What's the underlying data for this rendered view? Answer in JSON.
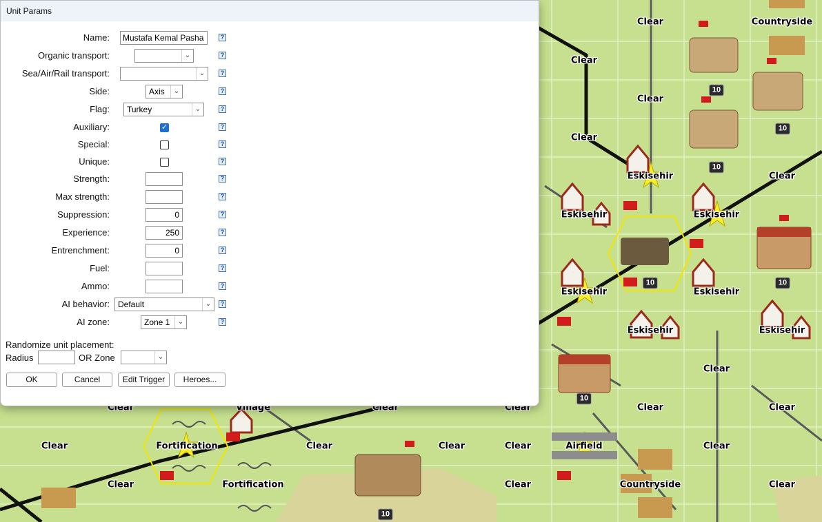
{
  "dialog": {
    "title": "Unit Params",
    "name_label": "Name:",
    "name_value": "Mustafa Kemal Pasha",
    "organic_transport_label": "Organic transport:",
    "organic_transport_value": "",
    "sea_air_rail_label": "Sea/Air/Rail transport:",
    "sea_air_rail_value": "",
    "side_label": "Side:",
    "side_value": "Axis",
    "flag_label": "Flag:",
    "flag_value": "Turkey",
    "auxiliary_label": "Auxiliary:",
    "auxiliary_checked": true,
    "special_label": "Special:",
    "special_checked": false,
    "unique_label": "Unique:",
    "unique_checked": false,
    "strength_label": "Strength:",
    "strength_value": "",
    "max_strength_label": "Max strength:",
    "max_strength_value": "",
    "suppression_label": "Suppression:",
    "suppression_value": "0",
    "experience_label": "Experience:",
    "experience_value": "250",
    "entrenchment_label": "Entrenchment:",
    "entrenchment_value": "0",
    "fuel_label": "Fuel:",
    "fuel_value": "",
    "ammo_label": "Ammo:",
    "ammo_value": "",
    "ai_behavior_label": "AI behavior:",
    "ai_behavior_value": "Default",
    "ai_zone_label": "AI zone:",
    "ai_zone_value": "Zone 1",
    "randomize_label": "Randomize unit placement:",
    "radius_label": "Radius",
    "radius_value": "",
    "or_zone_label": "OR Zone",
    "or_zone_value": "",
    "help_glyph": "?",
    "checkmark_glyph": "✓",
    "arrow_glyph": "⌄",
    "buttons": {
      "ok": "OK",
      "cancel": "Cancel",
      "edit_trigger": "Edit Trigger",
      "heroes": "Heroes..."
    }
  },
  "map": {
    "colors": {
      "terrain": "#c6e08f",
      "hex_line": "#e8f2cf",
      "road": "#5a5a5a",
      "rail": "#111111",
      "highlight": "#f2e600"
    },
    "labels": [
      {
        "text": "Clear"
      },
      {
        "text": "Countryside"
      },
      {
        "text": "Clear"
      },
      {
        "text": "Clear"
      },
      {
        "text": "Clear"
      },
      {
        "text": "Eskisehir"
      },
      {
        "text": "Clear"
      },
      {
        "text": "Eskisehir"
      },
      {
        "text": "Eskisehir"
      },
      {
        "text": "Eskisehir"
      },
      {
        "text": "Eskisehir"
      },
      {
        "text": "Eskisehir"
      },
      {
        "text": "Eskisehir"
      },
      {
        "text": "Clear"
      },
      {
        "text": "Clear"
      },
      {
        "text": "Clear"
      },
      {
        "text": "Airfield"
      },
      {
        "text": "Clear"
      },
      {
        "text": "Countryside"
      },
      {
        "text": "Clear"
      },
      {
        "text": "Clear"
      },
      {
        "text": "Clear"
      },
      {
        "text": "Village"
      },
      {
        "text": "Clear"
      },
      {
        "text": "Clear"
      },
      {
        "text": "Clear"
      },
      {
        "text": "Fortification"
      },
      {
        "text": "Clear"
      },
      {
        "text": "Clear"
      },
      {
        "text": "Clear"
      },
      {
        "text": "Fortification"
      },
      {
        "text": "Clear"
      }
    ],
    "badges": [
      "10",
      "10",
      "10",
      "10",
      "10",
      "10",
      "10",
      "10"
    ]
  }
}
